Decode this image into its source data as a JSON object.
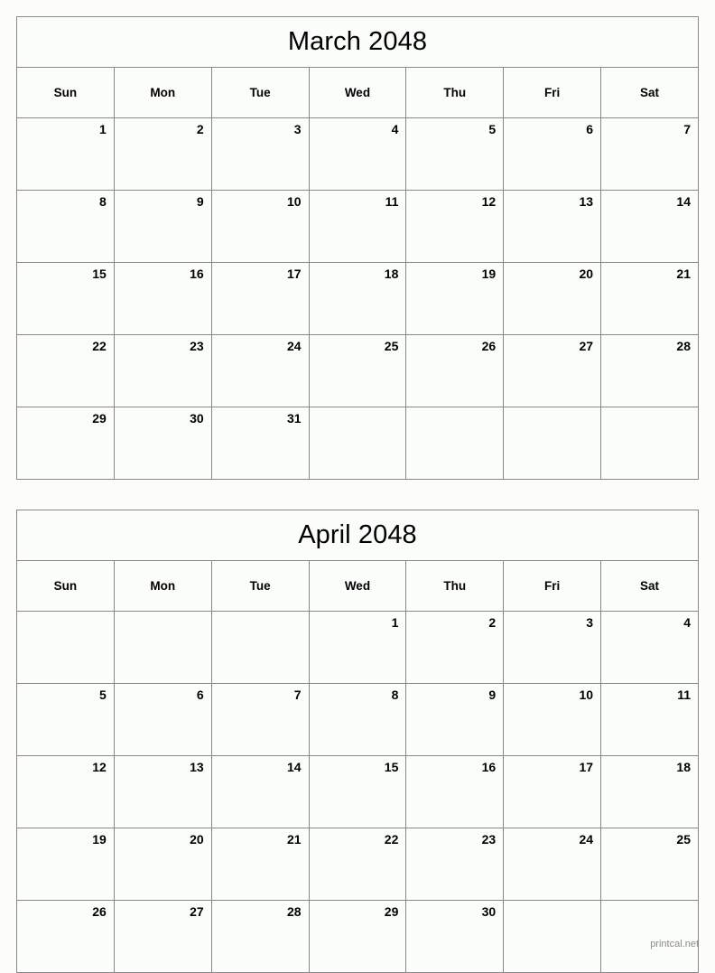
{
  "page": {
    "background_color": "#fcfdfa",
    "cell_background_color": "#fbfdfa",
    "border_color": "#888888",
    "text_color": "#000000",
    "footer_color": "#8b8b8b"
  },
  "footer": {
    "text": "printcal.net"
  },
  "weekday_headers": [
    "Sun",
    "Mon",
    "Tue",
    "Wed",
    "Thu",
    "Fri",
    "Sat"
  ],
  "calendars": [
    {
      "title": "March 2048",
      "month": "March",
      "year": "2048",
      "weeks": [
        [
          "1",
          "2",
          "3",
          "4",
          "5",
          "6",
          "7"
        ],
        [
          "8",
          "9",
          "10",
          "11",
          "12",
          "13",
          "14"
        ],
        [
          "15",
          "16",
          "17",
          "18",
          "19",
          "20",
          "21"
        ],
        [
          "22",
          "23",
          "24",
          "25",
          "26",
          "27",
          "28"
        ],
        [
          "29",
          "30",
          "31",
          "",
          "",
          "",
          ""
        ]
      ]
    },
    {
      "title": "April 2048",
      "month": "April",
      "year": "2048",
      "weeks": [
        [
          "",
          "",
          "",
          "1",
          "2",
          "3",
          "4"
        ],
        [
          "5",
          "6",
          "7",
          "8",
          "9",
          "10",
          "11"
        ],
        [
          "12",
          "13",
          "14",
          "15",
          "16",
          "17",
          "18"
        ],
        [
          "19",
          "20",
          "21",
          "22",
          "23",
          "24",
          "25"
        ],
        [
          "26",
          "27",
          "28",
          "29",
          "30",
          "",
          ""
        ]
      ]
    }
  ]
}
